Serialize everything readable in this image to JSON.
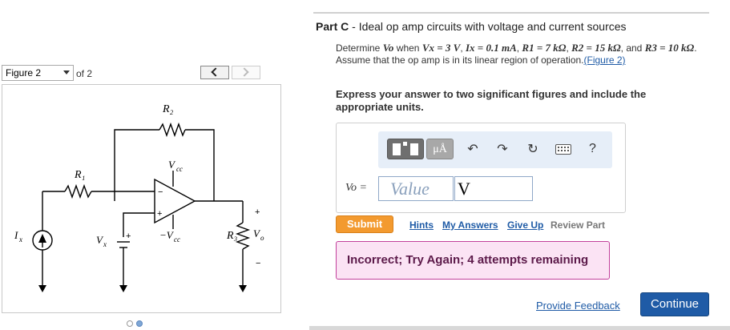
{
  "figure": {
    "selector_label": "Figure 2",
    "of_label": "of 2",
    "prev_label": "<",
    "next_label": ">",
    "circuit_labels": {
      "r2": "R₂",
      "r1": "R₁",
      "vcc_pos": "V",
      "vcc_pos_sub": "cc",
      "vcc_neg": "−V",
      "vcc_neg_sub": "cc",
      "r3": "R₃",
      "vo": "V",
      "vo_sub": "o",
      "vx": "V",
      "vx_sub": "x",
      "ix": "I",
      "ix_sub": "x",
      "plus": "+",
      "minus": "−"
    },
    "pages": 2,
    "current_page": 2
  },
  "question": {
    "part_label": "Part C",
    "part_title": "Ideal op amp circuits with voltage and current sources",
    "prompt_intro": "Determine",
    "prompt_vo": "Vo",
    "prompt_when": "when",
    "prompt_vals_1": "Vx = 3 V",
    "prompt_vals_2": "Ix = 0.1 mA",
    "prompt_vals_3": "R1 = 7 kΩ",
    "prompt_vals_4": "R2 = 15 kΩ",
    "prompt_and": "and",
    "prompt_vals_5": "R3 = 10 kΩ",
    "prompt_tail": ". Assume that the op amp is in its linear region of operation.",
    "figure_link": "(Figure 2)",
    "instruction": "Express your answer to two significant figures and include the appropriate units."
  },
  "answer": {
    "units_button": "μÅ",
    "help_label": "?",
    "var_label": "Vo =",
    "value_placeholder": "Value",
    "unit_value": "V"
  },
  "actions": {
    "submit": "Submit",
    "hints": "Hints",
    "my_answers": "My Answers",
    "give_up": "Give Up",
    "review_part": "Review Part",
    "feedback_message": "Incorrect; Try Again; 4 attempts remaining",
    "provide_feedback": "Provide Feedback",
    "continue": "Continue"
  },
  "colors": {
    "accent_blue": "#1f5ba6",
    "submit_orange": "#f39a2f",
    "error_pink_bg": "#fbe3f4",
    "error_border": "#c2409b"
  }
}
